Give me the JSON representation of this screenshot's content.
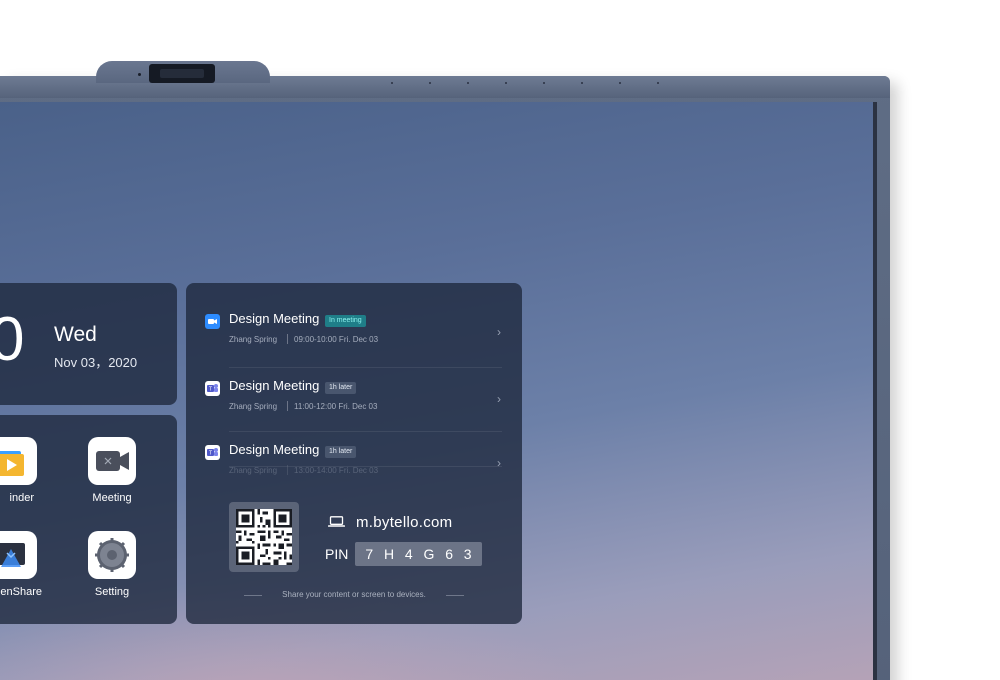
{
  "clock": {
    "time_visible": "0",
    "day": "Wed",
    "date": "Nov 03，2020"
  },
  "apps": [
    {
      "label": "inder",
      "icon": "folder-play-icon"
    },
    {
      "label": "Meeting",
      "icon": "video-camera-icon"
    },
    {
      "label": "eenShare",
      "icon": "screen-share-icon"
    },
    {
      "label": "Setting",
      "icon": "gear-icon"
    }
  ],
  "meetings": [
    {
      "title": "Design Meeting",
      "badge": "In meeting",
      "badge_type": "live",
      "icon": "zoom-icon",
      "host": "Zhang Spring",
      "time": "09:00-10:00 Fri. Dec 03"
    },
    {
      "title": "Design Meeting",
      "badge": "1h later",
      "badge_type": "later",
      "icon": "teams-icon",
      "host": "Zhang Spring",
      "time": "11:00-12:00 Fri. Dec 03"
    },
    {
      "title": "Design Meeting",
      "badge": "1h later",
      "badge_type": "later",
      "icon": "teams-icon",
      "host": "Zhang Spring",
      "time": "13:00-14:00 Fri. Dec 03"
    }
  ],
  "share": {
    "url": "m.bytello.com",
    "pin_label": "PIN",
    "pin": [
      "7",
      "H",
      "4",
      "G",
      "6",
      "3"
    ],
    "hint": "Share your content or screen to devices."
  },
  "colors": {
    "card_bg": "#1e283c",
    "live_badge": "#1f7e88",
    "later_badge": "#49566e",
    "zoom_blue": "#2d8cff",
    "teams_purple": "#5059c9"
  }
}
